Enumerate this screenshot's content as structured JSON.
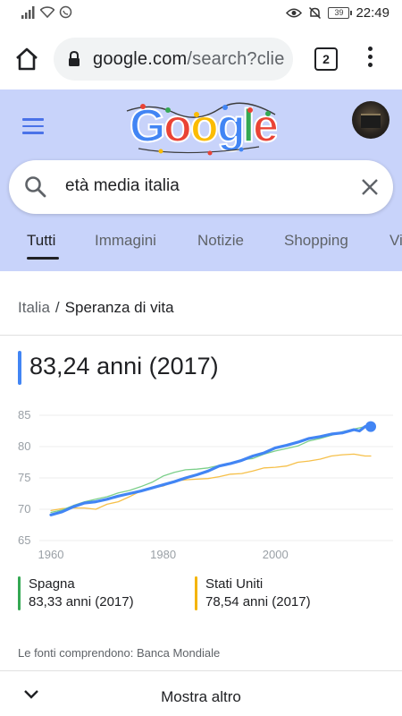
{
  "status_bar": {
    "time": "22:49",
    "battery": "39"
  },
  "browser": {
    "url_domain": "google.com",
    "url_path": "/search?clie",
    "tab_count": "2"
  },
  "search": {
    "query": "età media italia"
  },
  "tabs": [
    {
      "label": "Tutti",
      "active": true
    },
    {
      "label": "Immagini"
    },
    {
      "label": "Notizie"
    },
    {
      "label": "Shopping"
    },
    {
      "label": "Vi"
    }
  ],
  "result": {
    "breadcrumb_parent": "Italia",
    "breadcrumb_separator": "/",
    "breadcrumb_current": "Speranza di vita",
    "main_value": "83,24 anni (2017)",
    "legend": [
      {
        "name": "Spagna",
        "value": "83,33 anni (2017)",
        "color": "#34a853"
      },
      {
        "name": "Stati Uniti",
        "value": "78,54 anni (2017)",
        "color": "#f4b400"
      }
    ],
    "sources": "Le fonti comprendono: Banca Mondiale",
    "more_label": "Mostra altro"
  },
  "colors": {
    "italy": "#4285f4",
    "spain": "#7ccf8a",
    "usa": "#f6c04a",
    "header_bg": "#c8d3fa"
  },
  "chart_data": {
    "type": "line",
    "xlim": [
      1960,
      2017
    ],
    "ylim": [
      65,
      85
    ],
    "x_ticks": [
      1960,
      1980,
      2000
    ],
    "y_ticks": [
      65,
      70,
      75,
      80,
      85
    ],
    "series": [
      {
        "name": "Italia",
        "x": [
          1960,
          1962,
          1964,
          1966,
          1968,
          1970,
          1972,
          1974,
          1976,
          1978,
          1980,
          1982,
          1984,
          1986,
          1988,
          1990,
          1992,
          1994,
          1996,
          1998,
          2000,
          2002,
          2004,
          2006,
          2008,
          2010,
          2012,
          2014,
          2015,
          2016,
          2017
        ],
        "values": [
          69.1,
          69.6,
          70.4,
          71.0,
          71.2,
          71.6,
          72.1,
          72.5,
          72.9,
          73.4,
          73.9,
          74.4,
          75.0,
          75.5,
          76.1,
          76.9,
          77.3,
          77.8,
          78.5,
          79.0,
          79.8,
          80.2,
          80.7,
          81.3,
          81.6,
          82.0,
          82.2,
          82.7,
          82.5,
          83.2,
          83.2
        ]
      },
      {
        "name": "Spagna",
        "x": [
          1960,
          1962,
          1964,
          1966,
          1968,
          1970,
          1972,
          1974,
          1976,
          1978,
          1980,
          1982,
          1984,
          1986,
          1988,
          1990,
          1992,
          1994,
          1996,
          1998,
          2000,
          2002,
          2004,
          2006,
          2008,
          2010,
          2012,
          2014,
          2016,
          2017
        ],
        "values": [
          69.5,
          69.9,
          70.6,
          71.2,
          71.6,
          72.0,
          72.6,
          73.0,
          73.6,
          74.3,
          75.3,
          75.9,
          76.3,
          76.4,
          76.6,
          77.0,
          77.4,
          77.9,
          78.1,
          78.8,
          79.3,
          79.7,
          80.1,
          80.9,
          81.3,
          81.8,
          82.4,
          82.8,
          83.2,
          83.3
        ]
      },
      {
        "name": "Stati Uniti",
        "x": [
          1960,
          1962,
          1964,
          1966,
          1968,
          1970,
          1972,
          1974,
          1976,
          1978,
          1980,
          1982,
          1984,
          1986,
          1988,
          1990,
          1992,
          1994,
          1996,
          1998,
          2000,
          2002,
          2004,
          2006,
          2008,
          2010,
          2012,
          2014,
          2016,
          2017
        ],
        "values": [
          69.8,
          70.1,
          70.2,
          70.2,
          70.0,
          70.8,
          71.2,
          72.0,
          72.9,
          73.5,
          73.7,
          74.5,
          74.7,
          74.8,
          74.9,
          75.2,
          75.6,
          75.7,
          76.1,
          76.6,
          76.7,
          76.9,
          77.5,
          77.7,
          78.0,
          78.5,
          78.7,
          78.8,
          78.5,
          78.5
        ]
      }
    ]
  }
}
